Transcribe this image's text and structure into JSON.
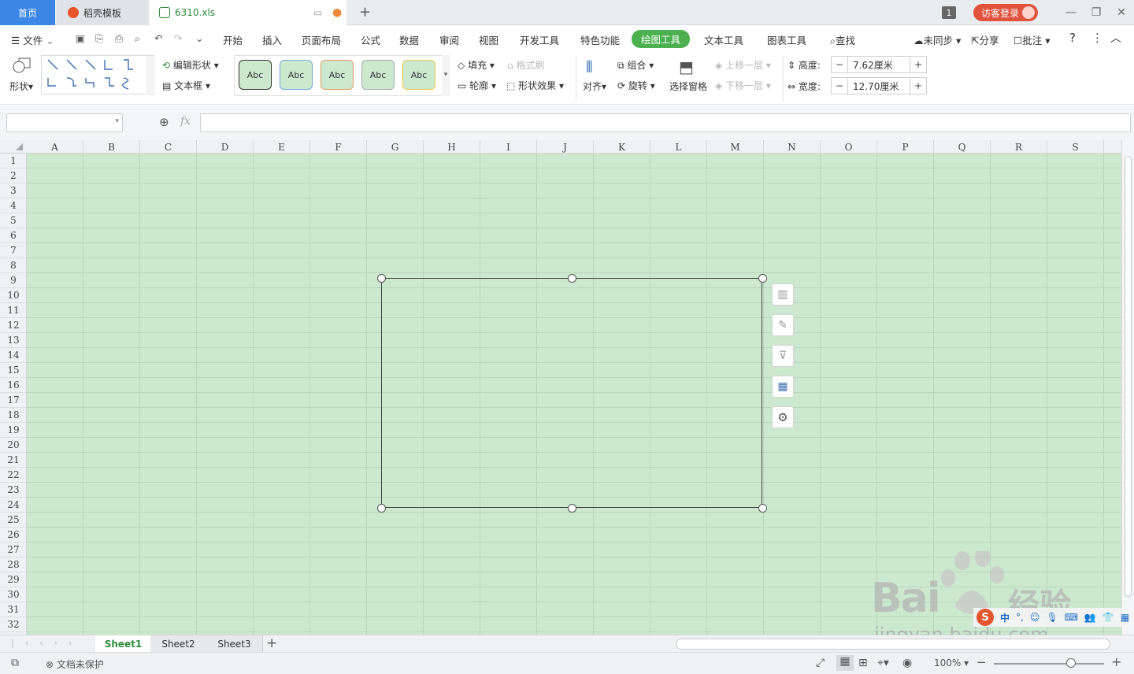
{
  "titlebar": {
    "tabs": [
      {
        "label": "首页",
        "active": false
      },
      {
        "label": "稻壳模板",
        "active": false
      },
      {
        "label": "6310.xls",
        "active": true
      }
    ],
    "window_count": "1",
    "login_label": "访客登录"
  },
  "menu": {
    "file_label": "文件",
    "items": [
      "开始",
      "插入",
      "页面布局",
      "公式",
      "数据",
      "审阅",
      "视图",
      "开发工具",
      "特色功能",
      "绘图工具",
      "文本工具",
      "图表工具"
    ],
    "search_label": "查找",
    "sync_label": "未同步",
    "share_label": "分享",
    "comment_label": "批注"
  },
  "ribbon": {
    "shape_label": "形状",
    "edit_shape_label": "编辑形状",
    "textbox_label": "文本框",
    "style_sample": "Abc",
    "fill_label": "填充",
    "format_painter_label": "格式刷",
    "outline_label": "轮廓",
    "shape_effect_label": "形状效果",
    "align_label": "对齐",
    "group_label": "组合",
    "rotate_label": "旋转",
    "selection_pane_label": "选择窗格",
    "bring_forward_label": "上移一层",
    "send_backward_label": "下移一层",
    "height_label": "高度:",
    "height_value": "7.62厘米",
    "width_label": "宽度:",
    "width_value": "12.70厘米"
  },
  "formula": {
    "fx_label": "fx",
    "name_box": "",
    "content": ""
  },
  "grid": {
    "columns": [
      "A",
      "B",
      "C",
      "D",
      "E",
      "F",
      "G",
      "H",
      "I",
      "J",
      "K",
      "L",
      "M",
      "N",
      "O",
      "P",
      "Q",
      "R",
      "S"
    ],
    "rows": [
      "1",
      "2",
      "3",
      "4",
      "5",
      "6",
      "7",
      "8",
      "9",
      "10",
      "11",
      "12",
      "13",
      "14",
      "15",
      "16",
      "17",
      "18",
      "19",
      "20",
      "21",
      "22",
      "23",
      "24",
      "25",
      "26",
      "27",
      "28",
      "29",
      "30",
      "31",
      "32"
    ],
    "cell_color": "#cce8cf"
  },
  "sheets": {
    "tabs": [
      "Sheet1",
      "Sheet2",
      "Sheet3"
    ],
    "active": "Sheet1"
  },
  "status": {
    "protect_label": "文档未保护",
    "zoom": "100%",
    "zoom_fraction": 0.7
  },
  "watermark": {
    "brand": "Bai",
    "brand_cn": "经验",
    "url": "jingyan.baidu.com",
    "ime_label": "中"
  }
}
